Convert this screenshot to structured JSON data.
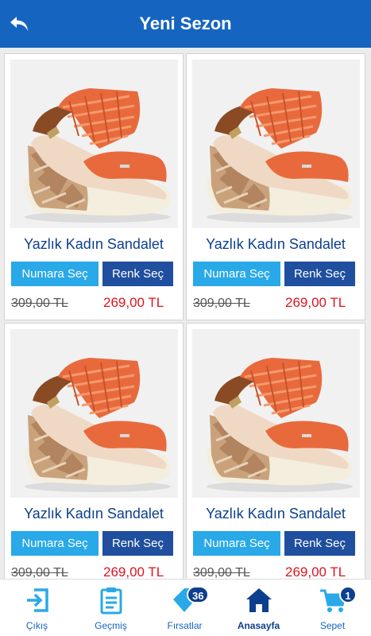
{
  "header": {
    "title": "Yeni Sezon",
    "back_icon": "back-arrow-icon"
  },
  "products": [
    {
      "name": "Yazlık Kadın Sandalet",
      "size_button": "Numara Seç",
      "color_button": "Renk Seç",
      "old_price": "309,00 TL",
      "new_price": "269,00 TL"
    },
    {
      "name": "Yazlık Kadın Sandalet",
      "size_button": "Numara Seç",
      "color_button": "Renk Seç",
      "old_price": "309,00 TL",
      "new_price": "269,00 TL"
    },
    {
      "name": "Yazlık Kadın Sandalet",
      "size_button": "Numara Seç",
      "color_button": "Renk Seç",
      "old_price": "309,00 TL",
      "new_price": "269,00 TL"
    },
    {
      "name": "Yazlık Kadın Sandalet",
      "size_button": "Numara Seç",
      "color_button": "Renk Seç",
      "old_price": "309,00 TL",
      "new_price": "269,00 TL"
    }
  ],
  "bottom_nav": {
    "items": [
      {
        "label": "Çıkış",
        "icon": "exit-icon"
      },
      {
        "label": "Geçmiş",
        "icon": "clipboard-history-icon"
      },
      {
        "label": "Fırsatlar",
        "icon": "tag-icon",
        "badge": "36"
      },
      {
        "label": "Anasayfa",
        "icon": "home-icon",
        "active": true
      },
      {
        "label": "Sepet",
        "icon": "cart-icon",
        "badge": "1"
      }
    ]
  },
  "colors": {
    "header_bg": "#1565c0",
    "product_name": "#0d3f8f",
    "size_button_bg": "#29a9e8",
    "color_button_bg": "#1f4f9e",
    "new_price": "#e0131e",
    "nav_icon": "#29a9e8",
    "nav_label": "#1565c0",
    "badge_bg": "#0d3f8f"
  }
}
